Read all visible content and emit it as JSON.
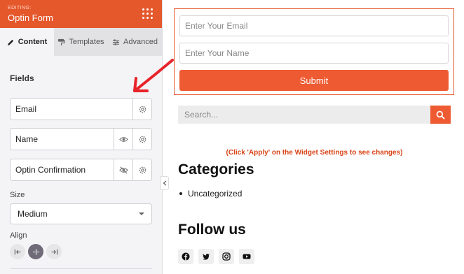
{
  "panel": {
    "editing_label": "EDITING:",
    "title": "Optin Form",
    "tabs": [
      {
        "label": "Content",
        "icon": "pencil-icon"
      },
      {
        "label": "Templates",
        "icon": "paint-roller-icon"
      },
      {
        "label": "Advanced",
        "icon": "sliders-icon"
      }
    ],
    "fields_title": "Fields",
    "fields": [
      {
        "label": "Email",
        "icons": [
          "gear-icon"
        ]
      },
      {
        "label": "Name",
        "icons": [
          "eye-icon",
          "gear-icon"
        ]
      },
      {
        "label": "Optin Confirmation",
        "icons": [
          "eye-slash-icon",
          "gear-icon"
        ]
      }
    ],
    "size_label": "Size",
    "size_value": "Medium",
    "align_label": "Align",
    "align_options": [
      "left",
      "center",
      "right"
    ],
    "align_selected": "center"
  },
  "preview": {
    "email_placeholder": "Enter Your Email",
    "name_placeholder": "Enter Your Name",
    "submit_label": "Submit",
    "search_placeholder": "Search...",
    "notice": "(Click 'Apply' on the Widget Settings to see changes)",
    "categories_heading": "Categories",
    "categories": [
      "Uncategorized"
    ],
    "follow_heading": "Follow us",
    "social_icons": [
      "facebook-icon",
      "twitter-icon",
      "instagram-icon",
      "youtube-icon"
    ]
  },
  "colors": {
    "accent": "#ee5a32",
    "header": "#e4582c",
    "notice": "#d84315",
    "arrow": "#e8232a"
  }
}
